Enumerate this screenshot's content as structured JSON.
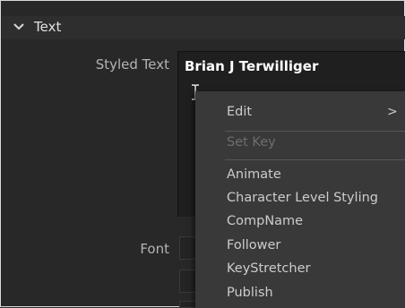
{
  "section": {
    "title": "Text"
  },
  "fields": {
    "styled_text_label": "Styled Text",
    "styled_text_value": "Brian J Terwilliger",
    "font_label": "Font"
  },
  "context_menu": {
    "edit": "Edit",
    "edit_arrow": ">",
    "set_key": "Set Key",
    "items": [
      "Animate",
      "Character Level Styling",
      "CompName",
      "Follower",
      "KeyStretcher",
      "Publish"
    ]
  }
}
